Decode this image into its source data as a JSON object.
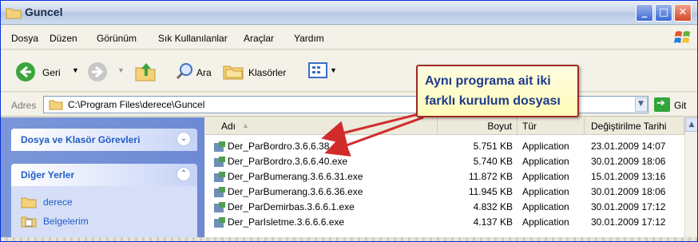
{
  "window": {
    "title": "Guncel"
  },
  "menu": [
    "Dosya",
    "Düzen",
    "Görünüm",
    "Sık Kullanılanlar",
    "Araçlar",
    "Yardım"
  ],
  "toolbar": {
    "back_label": "Geri",
    "search_label": "Ara",
    "folders_label": "Klasörler"
  },
  "address": {
    "label": "Adres",
    "path": "C:\\Program Files\\derece\\Guncel",
    "go_label": "Git"
  },
  "tasks": {
    "file_folder_tasks": "Dosya ve Klasör Görevleri",
    "other_places": "Diğer Yerler",
    "places": [
      "derece",
      "Belgelerim"
    ]
  },
  "columns": {
    "name": "Adı",
    "size": "Boyut",
    "type": "Tür",
    "modified": "Değiştirilme Tarihi"
  },
  "files": [
    {
      "name": "Der_ParBordro.3.6.6.38.exe",
      "size": "5.751 KB",
      "type": "Application",
      "modified": "23.01.2009 14:07"
    },
    {
      "name": "Der_ParBordro.3.6.6.40.exe",
      "size": "5.740 KB",
      "type": "Application",
      "modified": "30.01.2009 18:06"
    },
    {
      "name": "Der_ParBumerang.3.6.6.31.exe",
      "size": "11.872 KB",
      "type": "Application",
      "modified": "15.01.2009 13:16"
    },
    {
      "name": "Der_ParBumerang.3.6.6.36.exe",
      "size": "11.945 KB",
      "type": "Application",
      "modified": "30.01.2009 18:06"
    },
    {
      "name": "Der_ParDemirbas.3.6.6.1.exe",
      "size": "4.832 KB",
      "type": "Application",
      "modified": "30.01.2009 17:12"
    },
    {
      "name": "Der_ParIsletme.3.6.6.6.exe",
      "size": "4.137 KB",
      "type": "Application",
      "modified": "30.01.2009 17:12"
    }
  ],
  "callout": {
    "text": "Aynı programa ait iki farklı kurulum dosyası"
  },
  "colors": {
    "callout_border": "#9c2a25",
    "callout_text": "#1f3a8a",
    "arrow": "#d22b2b"
  }
}
